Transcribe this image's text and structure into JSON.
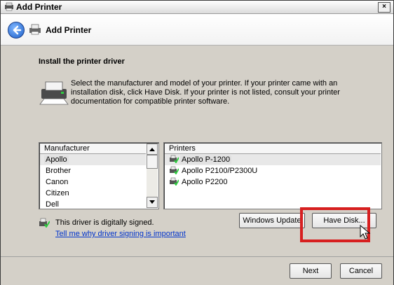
{
  "window": {
    "title": "Add Printer",
    "close_glyph": "×"
  },
  "nav": {
    "title": "Add Printer",
    "back_icon": "back-arrow-icon",
    "printer_icon": "printer-icon"
  },
  "section": {
    "heading": "Install the printer driver",
    "description": "Select the manufacturer and model of your printer. If your printer came with an installation disk, click Have Disk. If your printer is not listed, consult your printer documentation for compatible printer software."
  },
  "manufacturer_list": {
    "header": "Manufacturer",
    "items": [
      "Apollo",
      "Brother",
      "Canon",
      "Citizen",
      "Dell"
    ],
    "selected": "Apollo"
  },
  "printer_list": {
    "header": "Printers",
    "items": [
      "Apollo P-1200",
      "Apollo P2100/P2300U",
      "Apollo P2200"
    ],
    "selected": "Apollo P-1200"
  },
  "signing": {
    "status": "This driver is digitally signed.",
    "link": "Tell me why driver signing is important"
  },
  "buttons": {
    "windows_update": "Windows Update",
    "have_disk": "Have Disk...",
    "next": "Next",
    "cancel": "Cancel"
  },
  "colors": {
    "highlight_box": "#d71f1f",
    "link": "#0033cc"
  }
}
